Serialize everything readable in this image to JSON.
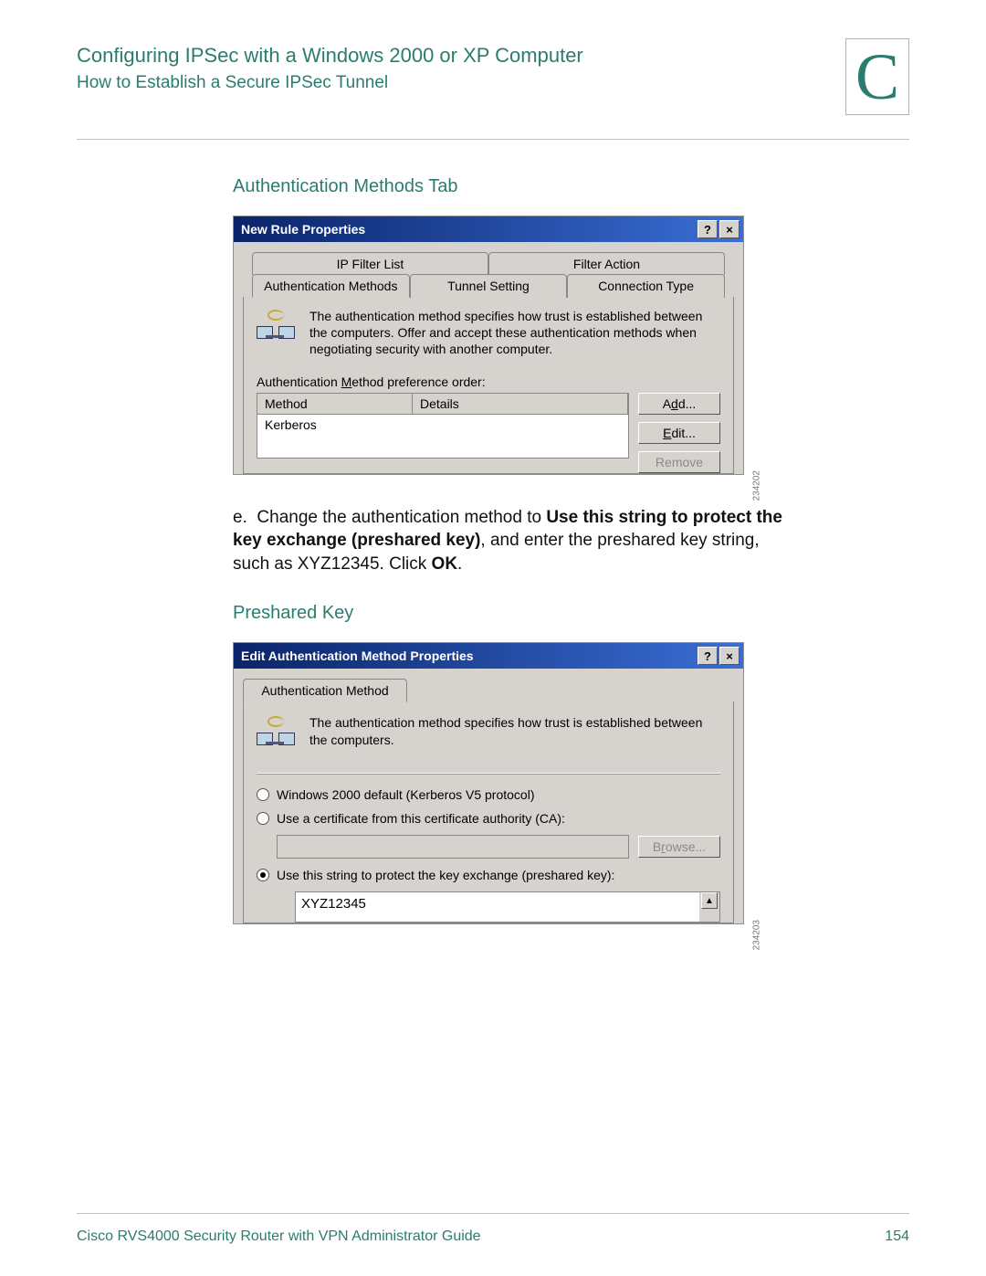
{
  "header": {
    "title": "Configuring IPSec with a Windows 2000 or XP Computer",
    "subtitle": "How to Establish a Secure IPSec Tunnel",
    "appendix_letter": "C"
  },
  "section1": {
    "title": "Authentication Methods Tab"
  },
  "dialog1": {
    "title": "New Rule Properties",
    "help_btn": "?",
    "close_btn": "×",
    "tabs_row1": [
      "IP Filter List",
      "Filter Action"
    ],
    "tabs_row2": [
      "Authentication Methods",
      "Tunnel Setting",
      "Connection Type"
    ],
    "description": "The authentication method specifies how trust is established between the computers. Offer and accept these authentication methods when negotiating security with another computer.",
    "preference_label": "Authentication Method preference order:",
    "col_method": "Method",
    "col_details": "Details",
    "row_method": "Kerberos",
    "btn_add": "Add...",
    "btn_edit": "Edit...",
    "btn_remove": "Remove",
    "fig_ref": "234202"
  },
  "step_e": {
    "prefix": "e.",
    "text1": "Change the authentication method to ",
    "bold1": "Use this string to protect the key exchange (preshared key)",
    "text2": ", and enter the preshared key string, such as XYZ12345. Click ",
    "bold2": "OK",
    "text3": "."
  },
  "section2": {
    "title": "Preshared Key"
  },
  "dialog2": {
    "title": "Edit Authentication Method Properties",
    "help_btn": "?",
    "close_btn": "×",
    "tab": "Authentication Method",
    "description": "The authentication method specifies how trust is established between the computers.",
    "opt_kerberos": "Windows 2000 default (Kerberos V5 protocol)",
    "opt_cert": "Use a certificate from this certificate authority (CA):",
    "btn_browse": "Browse...",
    "opt_preshared": "Use this string to protect the key exchange (preshared key):",
    "preshared_value": "XYZ12345",
    "fig_ref": "234203"
  },
  "footer": {
    "doc_title": "Cisco RVS4000 Security Router with VPN Administrator Guide",
    "page_number": "154"
  }
}
